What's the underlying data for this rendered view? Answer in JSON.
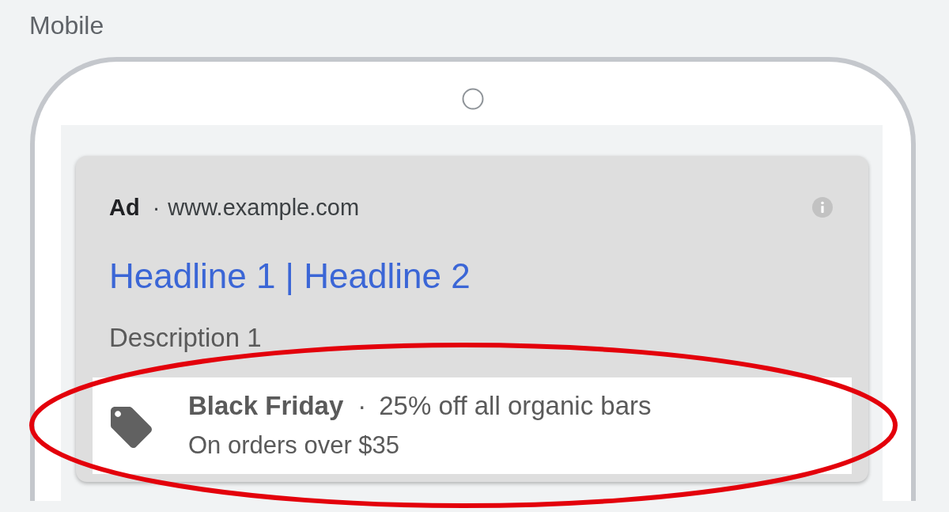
{
  "section_label": "Mobile",
  "ad": {
    "dimmed": true,
    "badge": "Ad",
    "separator": "·",
    "url": "www.example.com",
    "headline": "Headline 1 | Headline 2",
    "description": "Description 1",
    "promotion": {
      "occasion": "Black Friday",
      "separator": "·",
      "offer": "25% off all organic bars",
      "details": "On orders over $35"
    }
  },
  "annotation": {
    "kind": "ellipse"
  }
}
